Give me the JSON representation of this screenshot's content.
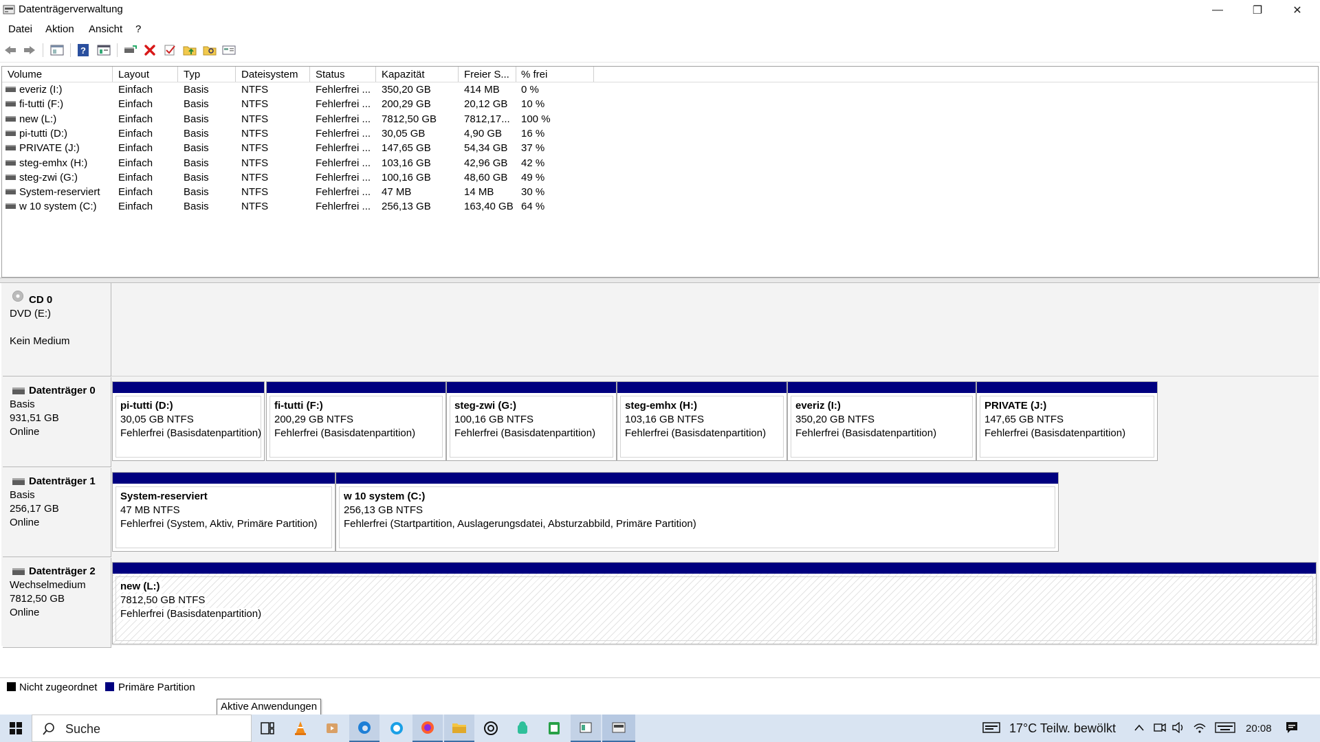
{
  "window": {
    "title": "Datenträgerverwaltung",
    "minimize": "—",
    "restore": "❐",
    "close": "✕"
  },
  "menu": [
    "Datei",
    "Aktion",
    "Ansicht",
    "?"
  ],
  "volume_table": {
    "columns": [
      "Volume",
      "Layout",
      "Typ",
      "Dateisystem",
      "Status",
      "Kapazität",
      "Freier S...",
      "% frei"
    ],
    "rows": [
      [
        "everiz (I:)",
        "Einfach",
        "Basis",
        "NTFS",
        "Fehlerfrei ...",
        "350,20 GB",
        "414 MB",
        "0 %"
      ],
      [
        "fi-tutti (F:)",
        "Einfach",
        "Basis",
        "NTFS",
        "Fehlerfrei ...",
        "200,29 GB",
        "20,12 GB",
        "10 %"
      ],
      [
        "new (L:)",
        "Einfach",
        "Basis",
        "NTFS",
        "Fehlerfrei ...",
        "7812,50 GB",
        "7812,17...",
        "100 %"
      ],
      [
        "pi-tutti (D:)",
        "Einfach",
        "Basis",
        "NTFS",
        "Fehlerfrei ...",
        "30,05 GB",
        "4,90 GB",
        "16 %"
      ],
      [
        "PRIVATE (J:)",
        "Einfach",
        "Basis",
        "NTFS",
        "Fehlerfrei ...",
        "147,65 GB",
        "54,34 GB",
        "37 %"
      ],
      [
        "steg-emhx (H:)",
        "Einfach",
        "Basis",
        "NTFS",
        "Fehlerfrei ...",
        "103,16 GB",
        "42,96 GB",
        "42 %"
      ],
      [
        "steg-zwi (G:)",
        "Einfach",
        "Basis",
        "NTFS",
        "Fehlerfrei ...",
        "100,16 GB",
        "48,60 GB",
        "49 %"
      ],
      [
        "System-reserviert",
        "Einfach",
        "Basis",
        "NTFS",
        "Fehlerfrei ...",
        "47 MB",
        "14 MB",
        "30 %"
      ],
      [
        "w 10 system (C:)",
        "Einfach",
        "Basis",
        "NTFS",
        "Fehlerfrei ...",
        "256,13 GB",
        "163,40 GB",
        "64 %"
      ]
    ]
  },
  "disks": [
    {
      "name": "CD 0",
      "lines": [
        "DVD (E:)",
        "",
        "Kein Medium"
      ],
      "partitions": []
    },
    {
      "name": "Datenträger 0",
      "lines": [
        "Basis",
        "931,51 GB",
        "Online"
      ],
      "partitions": [
        {
          "name": "pi-tutti  (D:)",
          "size": "30,05 GB NTFS",
          "status": "Fehlerfrei (Basisdatenpartition)"
        },
        {
          "name": "fi-tutti  (F:)",
          "size": "200,29 GB NTFS",
          "status": "Fehlerfrei (Basisdatenpartition)"
        },
        {
          "name": "steg-zwi  (G:)",
          "size": "100,16 GB NTFS",
          "status": "Fehlerfrei (Basisdatenpartition)"
        },
        {
          "name": "steg-emhx  (H:)",
          "size": "103,16 GB NTFS",
          "status": "Fehlerfrei (Basisdatenpartition)"
        },
        {
          "name": "everiz  (I:)",
          "size": "350,20 GB NTFS",
          "status": "Fehlerfrei (Basisdatenpartition)"
        },
        {
          "name": "PRIVATE  (J:)",
          "size": "147,65 GB NTFS",
          "status": "Fehlerfrei (Basisdatenpartition)"
        }
      ]
    },
    {
      "name": "Datenträger 1",
      "lines": [
        "Basis",
        "256,17 GB",
        "Online"
      ],
      "partitions": [
        {
          "name": "System-reserviert",
          "size": "47 MB NTFS",
          "status": "Fehlerfrei (System, Aktiv, Primäre Partition)"
        },
        {
          "name": "w 10 system  (C:)",
          "size": "256,13 GB NTFS",
          "status": "Fehlerfrei (Startpartition, Auslagerungsdatei, Absturzabbild, Primäre Partition)"
        }
      ]
    },
    {
      "name": "Datenträger 2",
      "lines": [
        "Wechselmedium",
        "7812,50 GB",
        "Online"
      ],
      "partitions": [
        {
          "name": "new  (L:)",
          "size": "7812,50 GB NTFS",
          "status": "Fehlerfrei (Basisdatenpartition)"
        }
      ]
    }
  ],
  "legend": {
    "unallocated": "Nicht zugeordnet",
    "primary": "Primäre Partition",
    "unallocated_color": "#000000",
    "primary_color": "#00007f"
  },
  "tooltip": "Aktive Anwendungen",
  "taskbar": {
    "search_placeholder": "Suche",
    "weather": "17°C  Teilw. bewölkt",
    "time": "20:08",
    "apps": [
      "task-view-icon",
      "vlc-icon",
      "media-icon",
      "edge-icon",
      "skype-icon",
      "firefox-icon",
      "explorer-icon",
      "app-icon",
      "android-icon",
      "spreadsheet-icon",
      "window-app-icon",
      "disk-management-icon"
    ]
  }
}
